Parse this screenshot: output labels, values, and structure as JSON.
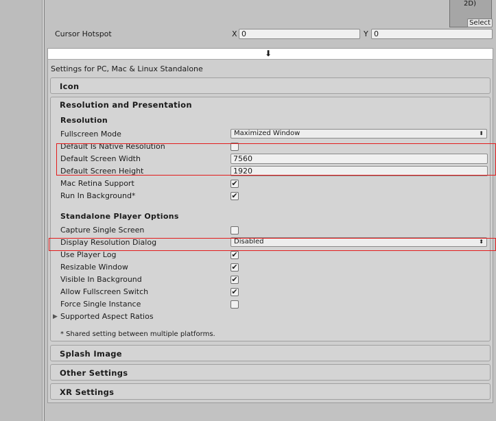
{
  "top": {
    "thumb_text": "2D)",
    "select_label": "Select",
    "cursor_hotspot_label": "Cursor Hotspot",
    "x_label": "X",
    "x_value": "0",
    "y_label": "Y",
    "y_value": "0"
  },
  "import_icon": "⬇",
  "settings_for": "Settings for PC, Mac & Linux Standalone",
  "sections": {
    "icon": "Icon",
    "resolution_presentation": "Resolution and Presentation",
    "splash": "Splash Image",
    "other": "Other Settings",
    "xr": "XR Settings"
  },
  "resolution": {
    "header": "Resolution",
    "fullscreen_mode_label": "Fullscreen Mode",
    "fullscreen_mode_value": "Maximized Window",
    "default_native_label": "Default Is Native Resolution",
    "default_native_checked": false,
    "width_label": "Default Screen Width",
    "width_value": "7560",
    "height_label": "Default Screen Height",
    "height_value": "1920",
    "retina_label": "Mac Retina Support",
    "retina_checked": true,
    "run_bg_label": "Run In Background*",
    "run_bg_checked": true
  },
  "standalone": {
    "header": "Standalone Player Options",
    "capture_label": "Capture Single Screen",
    "capture_checked": false,
    "display_dialog_label": "Display Resolution Dialog",
    "display_dialog_value": "Disabled",
    "player_log_label": "Use Player Log",
    "player_log_checked": true,
    "resizable_label": "Resizable Window",
    "resizable_checked": true,
    "visible_bg_label": "Visible In Background",
    "visible_bg_checked": true,
    "fullscreen_switch_label": "Allow Fullscreen Switch",
    "fullscreen_switch_checked": true,
    "force_single_label": "Force Single Instance",
    "force_single_checked": false,
    "aspect_label": "Supported Aspect Ratios",
    "shared_note": "* Shared setting between multiple platforms."
  },
  "glyphs": {
    "check": "✔",
    "triangle_right": "▶",
    "updown": "⬍"
  },
  "colors": {
    "highlight_red": "#e31a1a"
  }
}
